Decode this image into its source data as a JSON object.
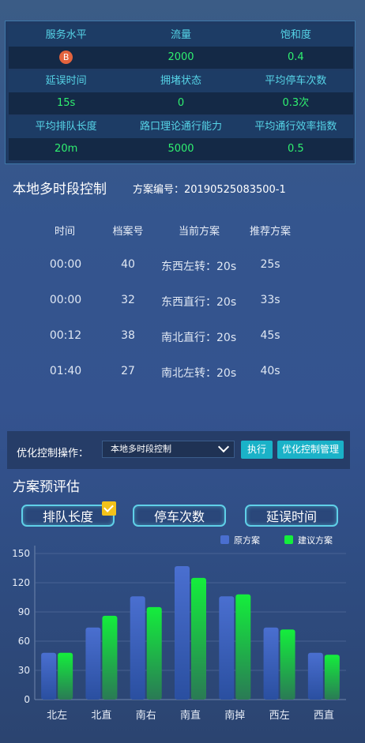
{
  "metrics": {
    "row1": {
      "labels": [
        "服务水平",
        "流量",
        "饱和度"
      ],
      "service_badge": "B",
      "flow": "2000",
      "saturation": "0.4"
    },
    "row2": {
      "labels": [
        "延误时间",
        "拥堵状态",
        "平均停车次数"
      ],
      "delay": "15s",
      "congestion": "0",
      "avg_stops": "0.3次"
    },
    "row3": {
      "labels": [
        "平均排队长度",
        "路口理论通行能力",
        "平均通行效率指数"
      ],
      "queue": "20m",
      "capacity": "5000",
      "efficiency": "0.5"
    }
  },
  "section1": {
    "title": "本地多时段控制",
    "plan_no": "方案编号：20190525083500-1"
  },
  "table": {
    "headers": [
      "时间",
      "档案号",
      "当前方案",
      "推荐方案"
    ],
    "rows": [
      {
        "time": "00:00",
        "file": "40",
        "current": "东西左转：20s",
        "recommend": "25s"
      },
      {
        "time": "00:00",
        "file": "32",
        "current": "东西直行：20s",
        "recommend": "33s"
      },
      {
        "time": "00:12",
        "file": "38",
        "current": "南北直行：20s",
        "recommend": "45s"
      },
      {
        "time": "01:40",
        "file": "27",
        "current": "南北左转：20s",
        "recommend": "40s"
      }
    ]
  },
  "ops": {
    "label": "优化控制操作：",
    "select_value": "本地多时段控制",
    "execute": "执行",
    "manage": "优化控制管理"
  },
  "section2": {
    "title": "方案预评估",
    "tabs": [
      "排队长度",
      "停车次数",
      "延误时间"
    ]
  },
  "colors": {
    "original": "#4a6fd0",
    "proposed": "#14ee3c"
  },
  "chart_data": {
    "type": "bar",
    "categories": [
      "北左",
      "北直",
      "南右",
      "南直",
      "南掉",
      "西左",
      "西直"
    ],
    "series": [
      {
        "name": "原方案",
        "values": [
          48,
          74,
          106,
          137,
          106,
          74,
          48
        ]
      },
      {
        "name": "建议方案",
        "values": [
          48,
          86,
          95,
          125,
          108,
          72,
          46
        ]
      }
    ],
    "ylim": [
      0,
      150
    ],
    "yticks": [
      "0",
      "30",
      "60",
      "90",
      "120",
      "150"
    ],
    "legend": "top-right",
    "grid": true
  }
}
